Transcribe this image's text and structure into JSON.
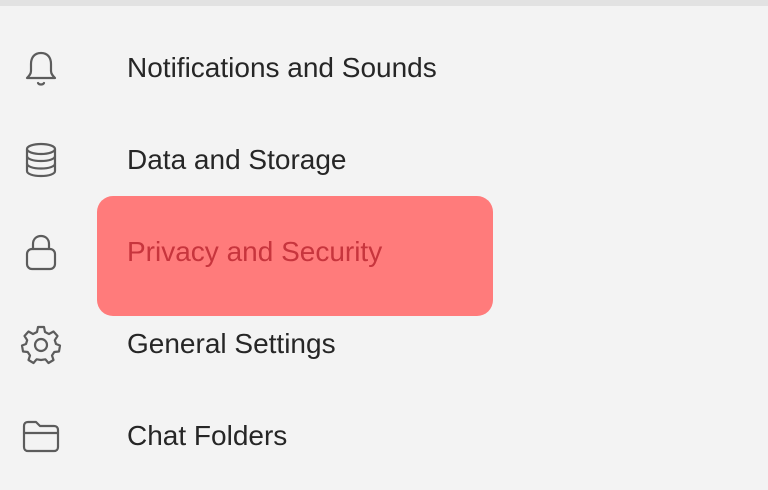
{
  "menu": {
    "items": [
      {
        "label": "Notifications and Sounds",
        "icon": "bell-icon"
      },
      {
        "label": "Data and Storage",
        "icon": "database-icon"
      },
      {
        "label": "Privacy and Security",
        "icon": "lock-icon",
        "highlighted": true
      },
      {
        "label": "General Settings",
        "icon": "gear-icon"
      },
      {
        "label": "Chat Folders",
        "icon": "folder-icon"
      }
    ]
  },
  "colors": {
    "background": "#f3f3f3",
    "highlight": "#ff7b7b",
    "highlight_text": "#c7353d",
    "text": "#262626",
    "icon": "#5c5c5c"
  }
}
